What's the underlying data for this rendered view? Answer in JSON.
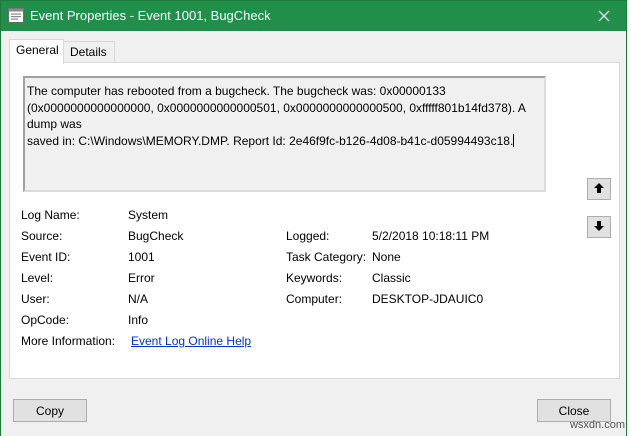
{
  "window": {
    "title": "Event Properties - Event 1001, BugCheck"
  },
  "tabs": [
    {
      "label": "General",
      "active": true
    },
    {
      "label": "Details",
      "active": false
    }
  ],
  "description": {
    "line1": "The computer has rebooted from a bugcheck.  The bugcheck was: 0x00000133",
    "line2": "(0x0000000000000000, 0x0000000000000501, 0x0000000000000500, 0xfffff801b14fd378). A dump was",
    "line3": "saved in: C:\\Windows\\MEMORY.DMP. Report Id: 2e46f9fc-b126-4d08-b41c-d05994493c18."
  },
  "fields": {
    "log_name": {
      "label": "Log Name:",
      "value": "System"
    },
    "source": {
      "label": "Source:",
      "value": "BugCheck"
    },
    "logged": {
      "label": "Logged:",
      "value": "5/2/2018 10:18:11 PM"
    },
    "event_id": {
      "label": "Event ID:",
      "value": "1001"
    },
    "task_category": {
      "label": "Task Category:",
      "value": "None"
    },
    "level": {
      "label": "Level:",
      "value": "Error"
    },
    "keywords": {
      "label": "Keywords:",
      "value": "Classic"
    },
    "user": {
      "label": "User:",
      "value": "N/A"
    },
    "computer": {
      "label": "Computer:",
      "value": "DESKTOP-JDAUIC0"
    },
    "opcode": {
      "label": "OpCode:",
      "value": "Info"
    },
    "more_info": {
      "label": "More Information:",
      "link_text": "Event Log Online Help"
    }
  },
  "buttons": {
    "copy": "Copy",
    "close": "Close"
  },
  "icons": {
    "app": "event-viewer-icon",
    "close": "close-icon",
    "up": "arrow-up-icon",
    "down": "arrow-down-icon"
  },
  "colors": {
    "titlebar": "#1f8f4a",
    "link": "#0033cc"
  },
  "watermark": "wsxdn.com"
}
